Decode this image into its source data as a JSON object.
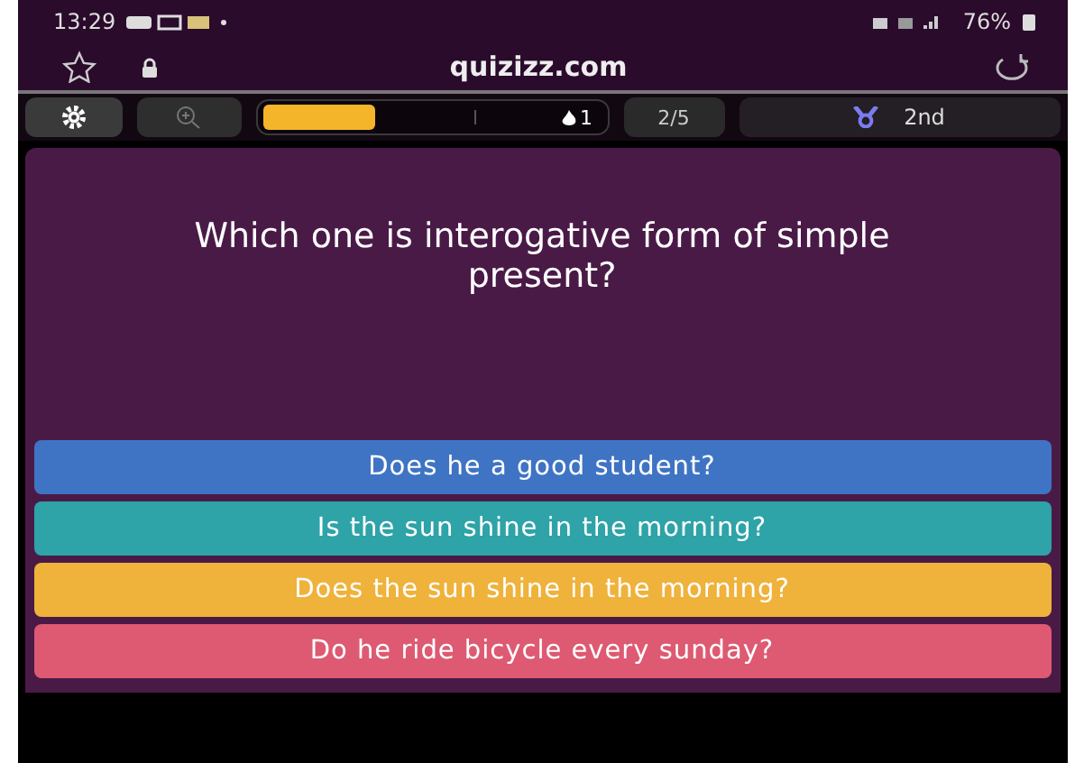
{
  "status_bar": {
    "time": "13:29",
    "battery": "76%"
  },
  "browser": {
    "url": "quizizz.com"
  },
  "toolbar": {
    "progress": {
      "level": 0.32
    },
    "streak": "1",
    "question_count": "2/5",
    "rank": "2nd"
  },
  "question": {
    "text": "Which one is interogative form of simple present?"
  },
  "answers": [
    {
      "text": "Does he a good student?",
      "color": "#3f74c4"
    },
    {
      "text": "Is the sun shine in the morning?",
      "color": "#2ea3a8"
    },
    {
      "text": "Does the sun shine in the morning?",
      "color": "#efb23b"
    },
    {
      "text": "Do he ride bicycle every sunday?",
      "color": "#dd5a72"
    }
  ]
}
